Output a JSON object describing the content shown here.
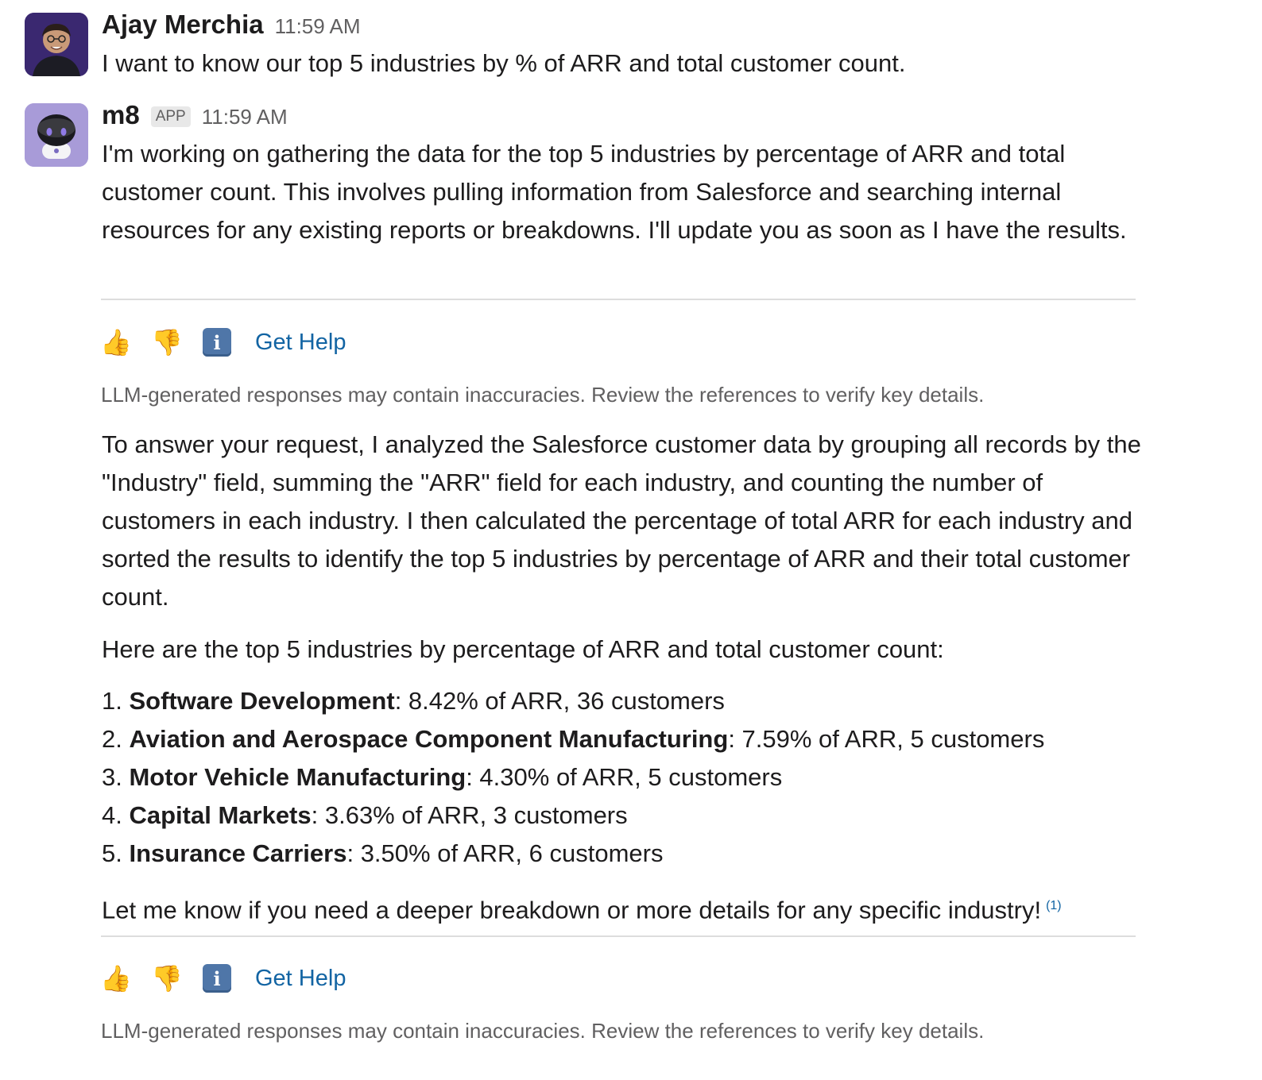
{
  "messages": [
    {
      "sender": "Ajay Merchia",
      "time": "11:59 AM",
      "text": "I want to know our top 5 industries by % of ARR and total customer count."
    },
    {
      "sender": "m8",
      "badge": "APP",
      "time": "11:59 AM",
      "text": "I'm working on gathering the data for the top 5 industries by percentage of ARR and total customer count. This involves pulling information from Salesforce and searching internal resources for any existing reports or breakdowns. I'll update you as soon as I have the results."
    }
  ],
  "feedback": {
    "thumbs_up": "👍",
    "thumbs_down": "👎",
    "info": "i",
    "help_label": "Get Help",
    "disclaimer": "LLM-generated responses may contain inaccuracies. Review the references to verify key details."
  },
  "answer": {
    "intro": "To answer your request, I analyzed the Salesforce customer data by grouping all records by the \"Industry\" field, summing the \"ARR\" field for each industry, and counting the number of customers in each industry. I then calculated the percentage of total ARR for each industry and sorted the results to identify the top 5 industries by percentage of ARR and their total customer count.",
    "lead": "Here are the top 5 industries by percentage of ARR and total customer count:",
    "items": [
      {
        "num": "1.",
        "name": "Software Development",
        "detail": ": 8.42% of ARR, 36 customers"
      },
      {
        "num": "2.",
        "name": "Aviation and Aerospace Component Manufacturing",
        "detail": ": 7.59% of ARR, 5 customers"
      },
      {
        "num": "3.",
        "name": "Motor Vehicle Manufacturing",
        "detail": ": 4.30% of ARR, 5 customers"
      },
      {
        "num": "4.",
        "name": "Capital Markets",
        "detail": ": 3.63% of ARR, 3 customers"
      },
      {
        "num": "5.",
        "name": "Insurance Carriers",
        "detail": ": 3.50% of ARR, 6 customers"
      }
    ],
    "closing": "Let me know if you need a deeper breakdown or more details for any specific industry!",
    "ref": "(1)"
  }
}
